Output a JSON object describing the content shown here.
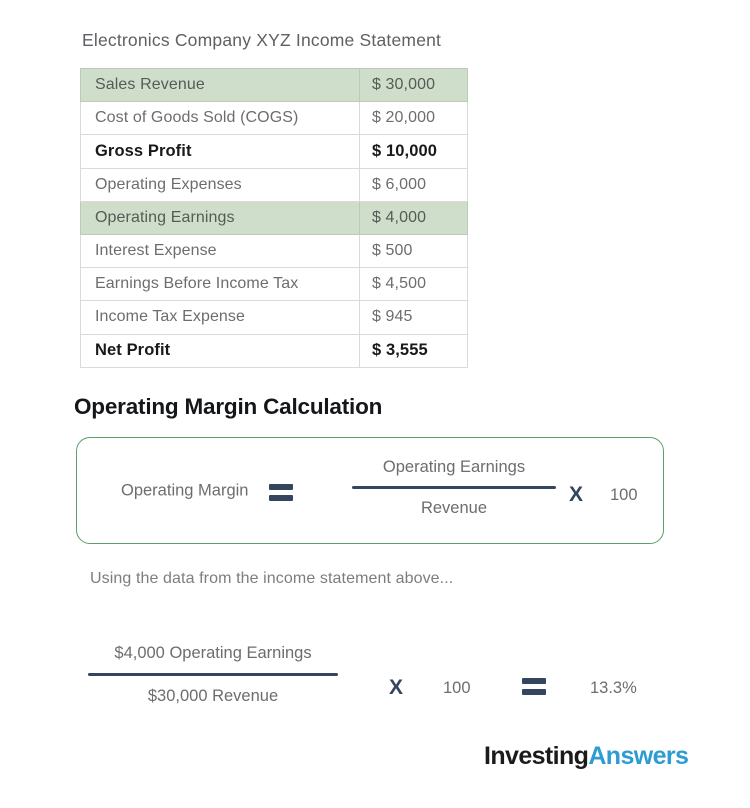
{
  "statement": {
    "title": "Electronics Company XYZ Income Statement",
    "rows": [
      {
        "label": "Sales Revenue",
        "value": "$ 30,000",
        "style": "highlight"
      },
      {
        "label": "Cost of Goods Sold (COGS)",
        "value": "$ 20,000",
        "style": "normal"
      },
      {
        "label": "Gross Profit",
        "value": "$ 10,000",
        "style": "bold"
      },
      {
        "label": "Operating Expenses",
        "value": "$ 6,000",
        "style": "normal"
      },
      {
        "label": "Operating Earnings",
        "value": "$ 4,000",
        "style": "highlight"
      },
      {
        "label": "Interest Expense",
        "value": "$ 500",
        "style": "normal"
      },
      {
        "label": "Earnings Before Income Tax",
        "value": "$ 4,500",
        "style": "normal"
      },
      {
        "label": "Income Tax Expense",
        "value": "$ 945",
        "style": "normal"
      },
      {
        "label": "Net Profit",
        "value": "$ 3,555",
        "style": "bold"
      }
    ]
  },
  "section": {
    "heading": "Operating Margin Calculation"
  },
  "formula": {
    "result_label": "Operating Margin",
    "equals": "=",
    "numerator": "Operating Earnings",
    "denominator": "Revenue",
    "times": "X",
    "multiplier": "100"
  },
  "note": "Using the data from the income statement above...",
  "worked_example": {
    "numerator": "$4,000 Operating Earnings",
    "denominator": "$30,000 Revenue",
    "times": "X",
    "multiplier": "100",
    "equals": "=",
    "result": "13.3%"
  },
  "logo": {
    "part1": "Investing",
    "part2": "Answers"
  },
  "colors": {
    "highlight_row": "#cfdecb",
    "table_border": "#d8dcd9",
    "formula_box_border": "#57a066",
    "navy": "#33455f",
    "body_text": "#6b6d70",
    "logo_blue": "#2d9cd2"
  }
}
